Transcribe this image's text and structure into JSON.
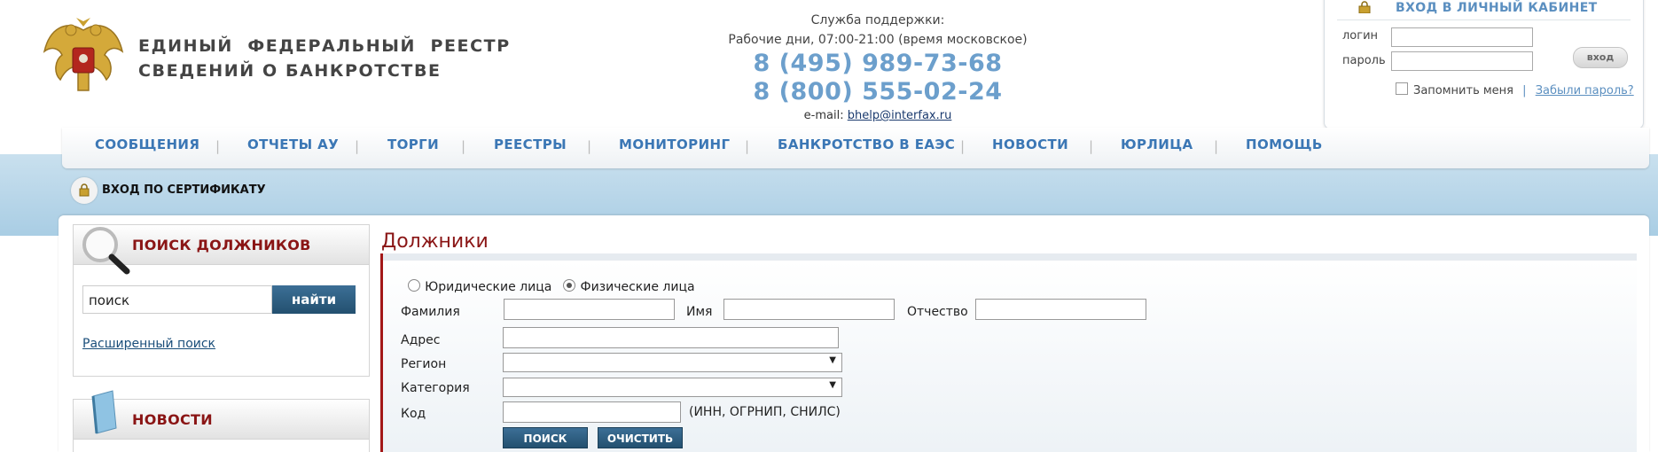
{
  "header": {
    "title_line1": "ЕДИНЫЙ  ФЕДЕРАЛЬНЫЙ  РЕЕСТР",
    "title_line2": "СВЕДЕНИЙ О БАНКРОТСТВЕ",
    "emblem_icon": "russian-coat-of-arms"
  },
  "support": {
    "label": "Служба поддержки:",
    "hours": "Рабочие дни, 07:00-21:00 (время московское)",
    "phone1": "8 (495) 989-73-68",
    "phone2": "8 (800) 555-02-24",
    "email_label": "e-mail:",
    "email": "bhelp@interfax.ru"
  },
  "login": {
    "title": "ВХОД В ЛИЧНЫЙ КАБИНЕТ",
    "login_label": "логин",
    "password_label": "пароль",
    "login_value": "",
    "password_value": "",
    "submit_label": "вход",
    "remember_label": "Запомнить меня",
    "separator": "|",
    "forgot_label": "Забыли пароль?"
  },
  "nav": {
    "items": [
      "СООБЩЕНИЯ",
      "ОТЧЕТЫ АУ",
      "ТОРГИ",
      "РЕЕСТРЫ",
      "МОНИТОРИНГ",
      "БАНКРОТСТВО В ЕАЭС",
      "НОВОСТИ",
      "ЮРЛИЦА",
      "ПОМОЩЬ"
    ],
    "separator": "|"
  },
  "cert": {
    "label": "ВХОД ПО СЕРТИФИКАТУ"
  },
  "sidebar": {
    "search_title": "ПОИСК ДОЛЖНИКОВ",
    "search_value": "поиск",
    "search_button": "найти",
    "advanced_link": "Расширенный поиск",
    "news_title": "НОВОСТИ"
  },
  "main": {
    "title": "Должники",
    "radio_legal": "Юридические лица",
    "radio_person": "Физические лица",
    "selected": "Физические лица",
    "labels": {
      "surname": "Фамилия",
      "name": "Имя",
      "patronymic": "Отчество",
      "address": "Адрес",
      "region": "Регион",
      "category": "Категория",
      "code": "Код",
      "code_hint": "(ИНН, ОГРНИП, СНИЛС)"
    },
    "values": {
      "surname": "",
      "name": "",
      "patronymic": "",
      "address": "",
      "region": "",
      "category": "",
      "code": ""
    },
    "search_button": "ПОИСК",
    "clear_button": "ОЧИСТИТЬ"
  },
  "colors": {
    "accent_blue": "#3b77b5",
    "phone_blue": "#6c9fcc",
    "dark_red": "#8a1515",
    "button_blue": "#23506f"
  }
}
